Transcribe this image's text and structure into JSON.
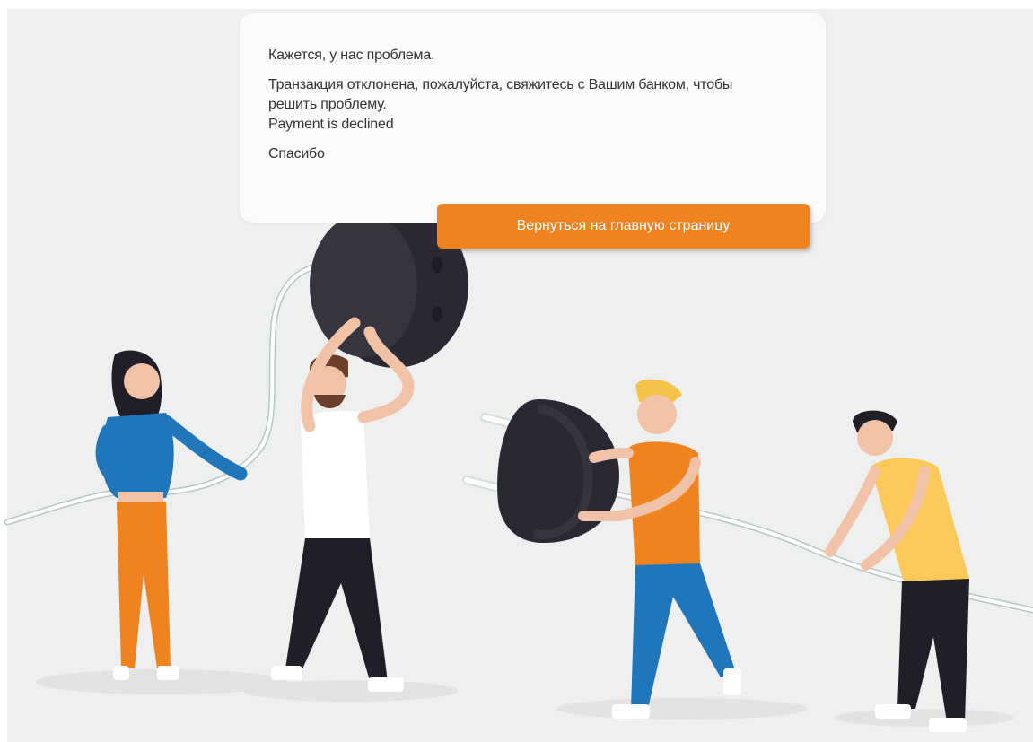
{
  "message": {
    "title": "Кажется, у нас проблема.",
    "body_ru_line1": "Транзакция отклонена, пожалуйста, свяжитесь с Вашим банком, чтобы",
    "body_ru_line2": "решить проблему.",
    "body_en": "Payment is declined",
    "thanks": "Спасибо"
  },
  "actions": {
    "home_button_label": "Вернуться на главную страницу"
  },
  "colors": {
    "background": "#eeefef",
    "card": "#fbfbfb",
    "button": "#ee8320",
    "plug": "#2a2833"
  }
}
